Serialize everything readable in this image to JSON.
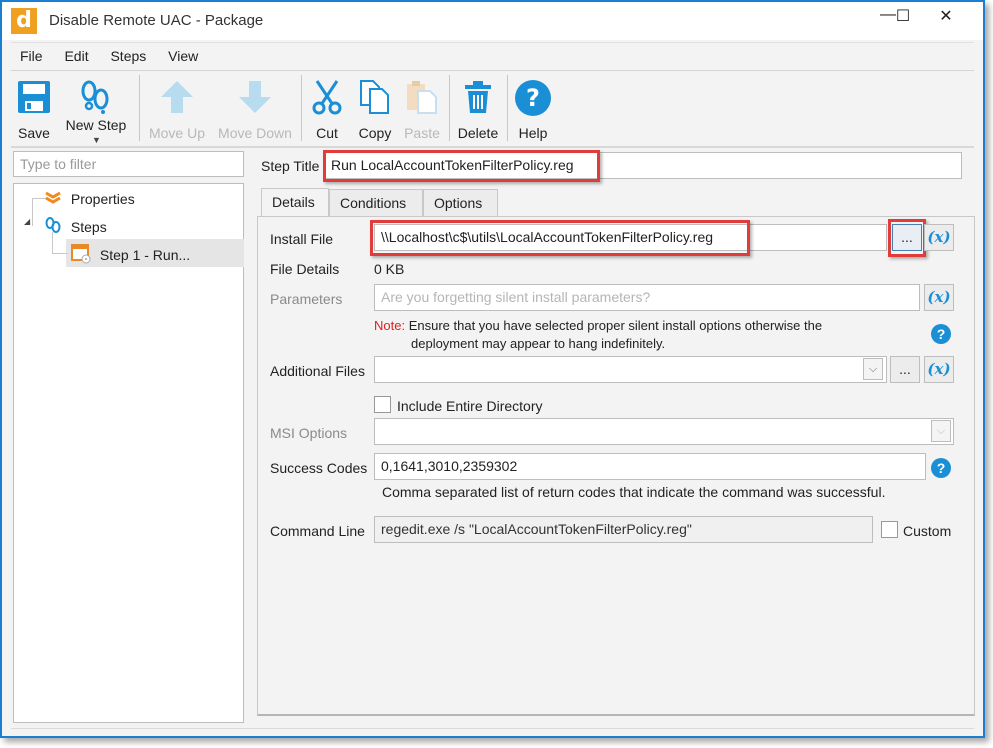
{
  "window": {
    "title": "Disable Remote UAC - Package",
    "logo_letter": "d",
    "minimize": "—",
    "maximize": "☐",
    "close": "✕"
  },
  "menu": [
    "File",
    "Edit",
    "Steps",
    "View"
  ],
  "toolbar": {
    "save": "Save",
    "new_step": "New Step",
    "move_up": "Move Up",
    "move_down": "Move Down",
    "cut": "Cut",
    "copy": "Copy",
    "paste": "Paste",
    "delete": "Delete",
    "help": "Help"
  },
  "sidebar": {
    "filter_placeholder": "Type to filter",
    "tree": {
      "properties": "Properties",
      "steps": "Steps",
      "step1": "Step 1 - Run..."
    }
  },
  "form": {
    "step_title_label": "Step Title",
    "step_title_value": "Run LocalAccountTokenFilterPolicy.reg",
    "tabs": [
      "Details",
      "Conditions",
      "Options"
    ],
    "active_tab": "Details",
    "install_file_label": "Install File",
    "install_file_value": "\\\\Localhost\\c$\\utils\\LocalAccountTokenFilterPolicy.reg",
    "browse_label": "...",
    "variable_label": "(x)",
    "file_details_label": "File Details",
    "file_details_value": "0 KB",
    "parameters_label": "Parameters",
    "parameters_placeholder": "Are you forgetting silent install parameters?",
    "note_prefix": "Note:",
    "note_line1": "Ensure that you have selected proper silent install options otherwise the",
    "note_line2": "deployment may appear to hang indefinitely.",
    "additional_files_label": "Additional Files",
    "additional_files_value": "",
    "include_dir_label": "Include Entire Directory",
    "include_dir_checked": false,
    "msi_options_label": "MSI Options",
    "msi_options_value": "",
    "success_codes_label": "Success Codes",
    "success_codes_value": "0,1641,3010,2359302",
    "success_codes_hint": "Comma separated list of return codes that indicate the command was successful.",
    "command_line_label": "Command Line",
    "command_line_value": "regedit.exe /s \"LocalAccountTokenFilterPolicy.reg\"",
    "custom_label": "Custom",
    "custom_checked": false,
    "help_glyph": "?"
  },
  "colors": {
    "accent": "#1a8fd6",
    "highlight": "#e03c3c",
    "note": "#e02020",
    "logo": "#f0a020"
  }
}
